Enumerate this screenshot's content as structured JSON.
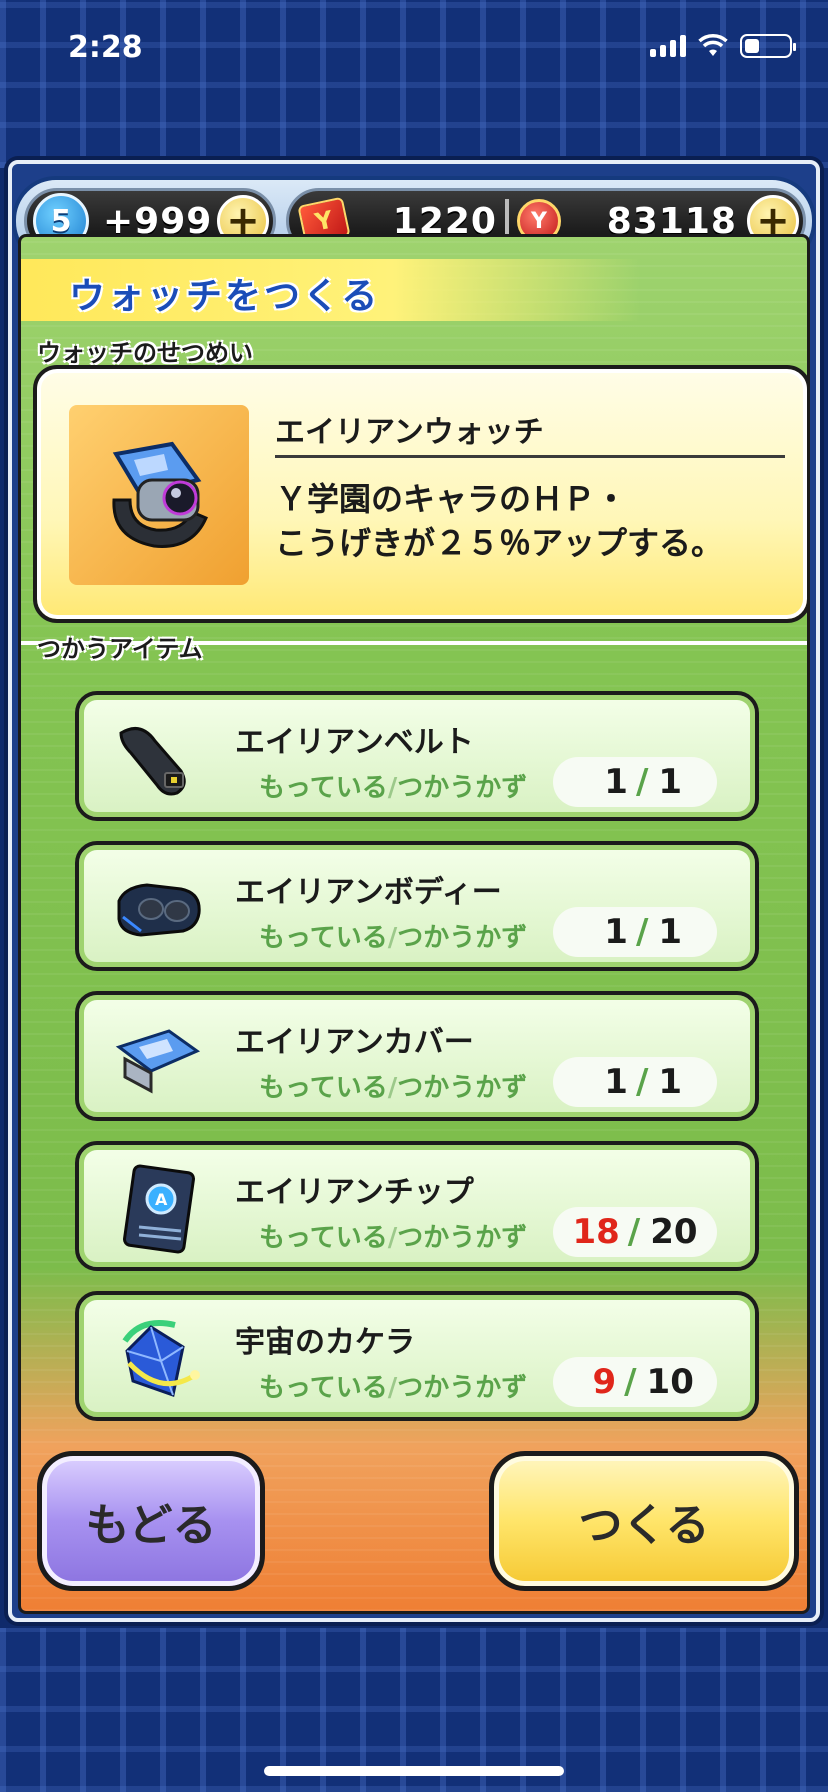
{
  "status_bar": {
    "time": "2:28"
  },
  "currency": {
    "stamina_level": "5",
    "stamina_value": "+999",
    "y_money": "1220",
    "y_money_icon": "Y",
    "coins": "83118",
    "coin_icon": "Y",
    "plus_label": "+"
  },
  "header": {
    "title": "ウォッチをつくる"
  },
  "description": {
    "section_label": "ウォッチのせつめい",
    "watch_name": "エイリアンウォッチ",
    "watch_text": "Ｙ学園のキャラのＨＰ・\nこうげきが２５％アップする。"
  },
  "items_section": {
    "section_label": "つかうアイテム",
    "sub_label_owned": "もっている",
    "sub_label_slash": "/",
    "sub_label_use": "つかうかず",
    "count_separator": "/",
    "items": [
      {
        "name": "エイリアンベルト",
        "owned": "1",
        "required": "1",
        "icon": "belt-icon"
      },
      {
        "name": "エイリアンボディー",
        "owned": "1",
        "required": "1",
        "icon": "watch-body-icon"
      },
      {
        "name": "エイリアンカバー",
        "owned": "1",
        "required": "1",
        "icon": "watch-cover-icon"
      },
      {
        "name": "エイリアンチップ",
        "owned": "18",
        "required": "20",
        "icon": "chip-icon"
      },
      {
        "name": "宇宙のカケラ",
        "owned": "9",
        "required": "10",
        "icon": "crystal-shard-icon"
      }
    ]
  },
  "buttons": {
    "back": "もどる",
    "make": "つくる"
  },
  "colors": {
    "shortage": "#e0261a",
    "panel_green": "#84c452",
    "title_blue": "#1b4db8"
  }
}
